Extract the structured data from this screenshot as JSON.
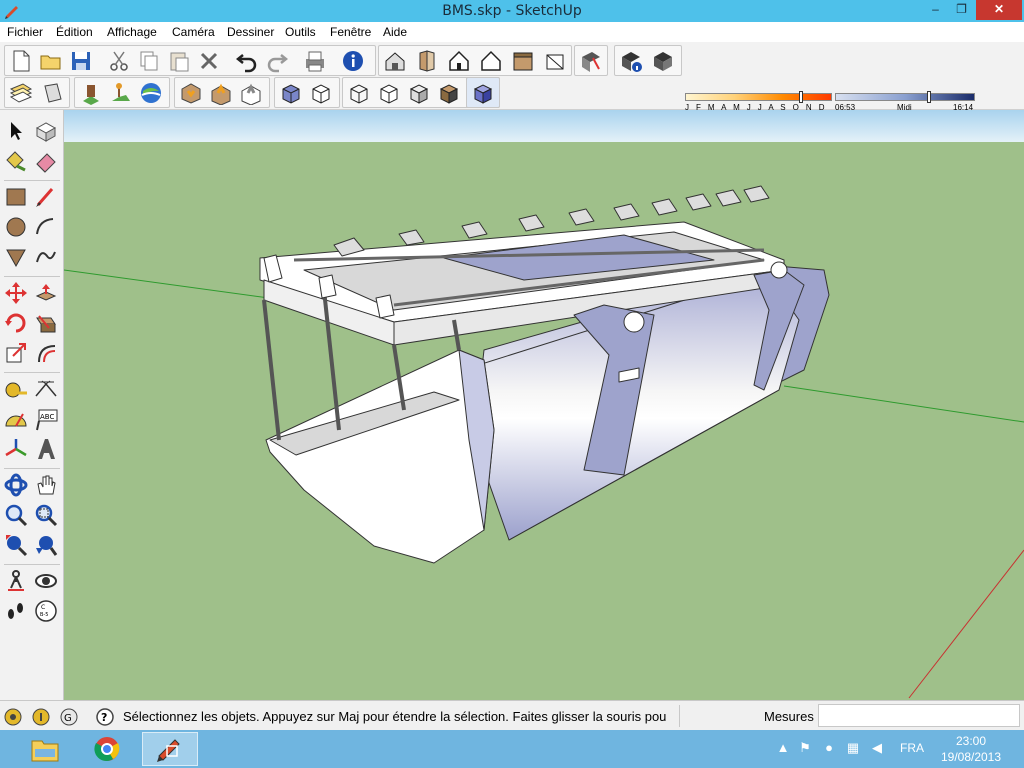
{
  "window": {
    "title": "BMS.skp - SketchUp",
    "minimize": "–",
    "maximize": "❐",
    "close": "✕"
  },
  "menu": {
    "items": [
      "Fichier",
      "Édition",
      "Affichage",
      "Caméra",
      "Dessiner",
      "Outils",
      "Fenêtre",
      "Aide"
    ]
  },
  "shadows": {
    "months": "J F M A M J J A S O N D",
    "time_start": "06:53",
    "time_mid": "Midi",
    "time_end": "16:14"
  },
  "status": {
    "message": "Sélectionnez les objets. Appuyez sur Maj pour étendre la sélection. Faites glisser la souris pou",
    "measure_label": "Mesures",
    "measure_value": ""
  },
  "taskbar": {
    "language": "FRA",
    "time": "23:00",
    "date": "19/08/2013"
  },
  "colors": {
    "sky_top": "#a9d3ee",
    "ground": "#9fc08a",
    "model_face": "#ffffff",
    "model_back": "#9ea3cc",
    "titlebar": "#4ec1ea",
    "taskbar": "#6fb5e0"
  }
}
